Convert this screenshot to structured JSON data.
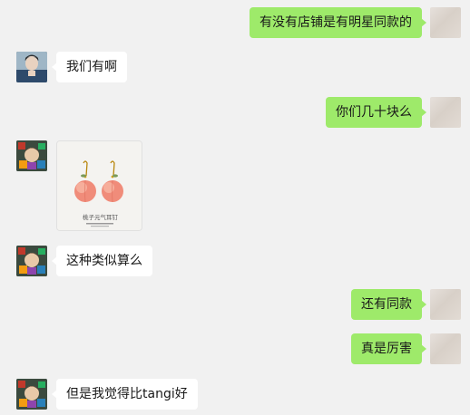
{
  "messages": [
    {
      "side": "out",
      "text": "有没有店铺是有明星同款的"
    },
    {
      "side": "in",
      "text": "我们有啊"
    },
    {
      "side": "out",
      "text": "你们几十块么"
    },
    {
      "side": "in",
      "type": "image",
      "image": {
        "subject": "peach-earrings",
        "caption": "桃子元气耳钉",
        "colors": {
          "peach": "#f08c7a",
          "leaf": "#7a9a5a",
          "hook": "#b8860b"
        }
      }
    },
    {
      "side": "in",
      "text": "这种类似算么"
    },
    {
      "side": "out",
      "text": "还有同款"
    },
    {
      "side": "out",
      "text": "真是厉害"
    },
    {
      "side": "in",
      "text": "但是我觉得比tangi好"
    }
  ],
  "colors": {
    "background": "#f1f1f1",
    "outgoing_bubble": "#9eea6a",
    "incoming_bubble": "#ffffff",
    "text": "#191919"
  }
}
